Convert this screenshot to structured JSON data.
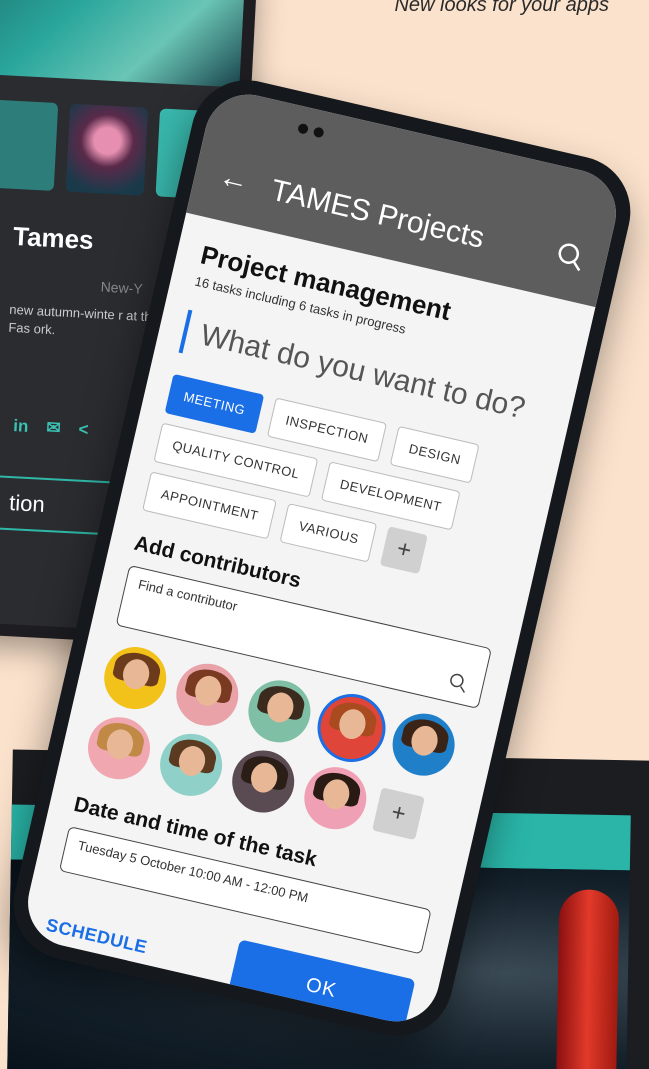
{
  "tagline": "New looks for your apps",
  "background_phone": {
    "name": "Tames",
    "location": "New-Y",
    "description": "new autumn-winte r at the Neon Fas ork.",
    "social": [
      "in",
      "✉",
      "<"
    ],
    "cta": "tion",
    "add_label": "+"
  },
  "app": {
    "title": "TAMES Projects",
    "back_icon": "arrow-left-icon",
    "search_icon": "search-icon",
    "heading": "Project management",
    "subheading": "16 tasks including 6 tasks in progress",
    "prompt": "What do you want to do?",
    "categories": [
      {
        "label": "MEETING",
        "active": true
      },
      {
        "label": "INSPECTION",
        "active": false
      },
      {
        "label": "DESIGN",
        "active": false
      },
      {
        "label": "QUALITY CONTROL",
        "active": false
      },
      {
        "label": "DEVELOPMENT",
        "active": false
      },
      {
        "label": "APPOINTMENT",
        "active": false
      },
      {
        "label": "VARIOUS",
        "active": false
      }
    ],
    "add_category_label": "+",
    "contributors_heading": "Add contributors",
    "contributor_search_placeholder": "Find a contributor",
    "add_contributor_label": "+",
    "datetime_heading": "Date and time of the task",
    "datetime_value": "Tuesday 5 October 10:00 AM - 12:00 PM",
    "schedule_label": "SCHEDULE",
    "ok_label": "OK"
  },
  "colors": {
    "accent": "#1a6ee6",
    "appbar": "#5d5d5d",
    "background": "#fbe2cc",
    "teal": "#2ab5a8"
  }
}
